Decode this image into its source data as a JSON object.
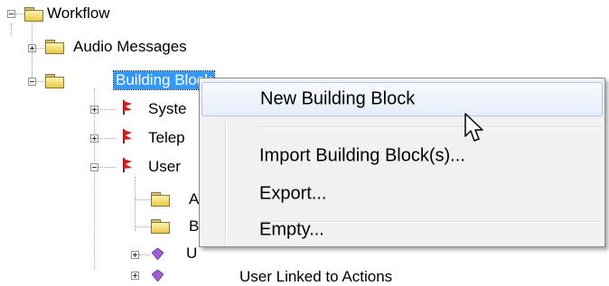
{
  "tree": {
    "root_label": "Workflow",
    "items": [
      {
        "label": "Audio Messages",
        "expander": "+"
      },
      {
        "label": "Building Block",
        "expander": "-",
        "selected": true
      },
      {
        "label": "Syste",
        "expander": "+"
      },
      {
        "label": "Telep",
        "expander": "+"
      },
      {
        "label": "User",
        "expander": "-"
      },
      {
        "label": "A"
      },
      {
        "label": "B"
      },
      {
        "label": "U",
        "expander": "+"
      },
      {
        "label": "User Linked to Actions",
        "expander": "+"
      }
    ]
  },
  "context_menu": {
    "items": [
      {
        "label": "New Building Block",
        "highlighted": true
      },
      {
        "label": "Import Building Block(s)..."
      },
      {
        "label": "Export..."
      },
      {
        "label": "Empty..."
      }
    ]
  },
  "colors": {
    "selection": "#3399ff",
    "menu_background": "#f1f1f1",
    "menu_highlight_border": "#a8c8ec",
    "folder": "#e9c94a",
    "building_block_icon": "#d62020",
    "gem_icon": "#9b5fd0"
  }
}
